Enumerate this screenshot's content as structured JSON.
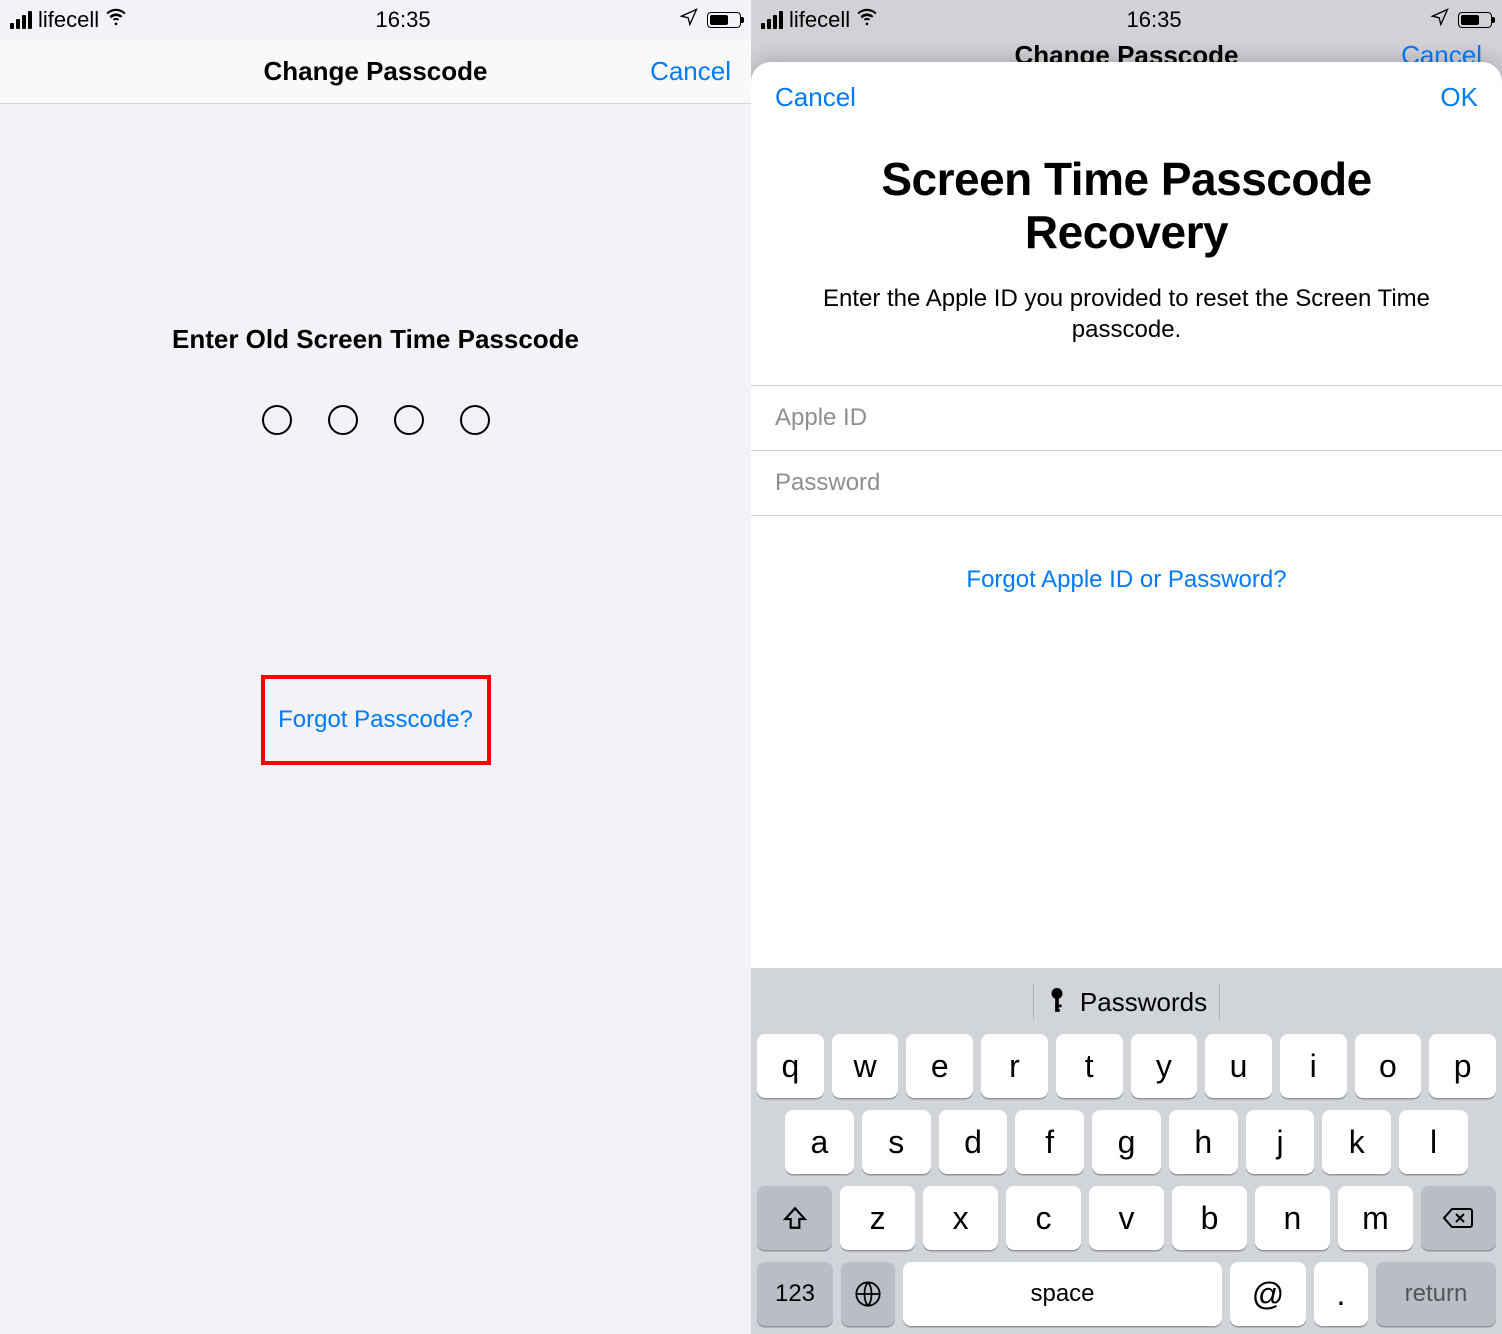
{
  "status": {
    "carrier": "lifecell",
    "time": "16:35"
  },
  "left": {
    "nav_title": "Change Passcode",
    "nav_cancel": "Cancel",
    "prompt": "Enter Old Screen Time Passcode",
    "forgot": "Forgot Passcode?"
  },
  "right": {
    "behind_title": "Change Passcode",
    "behind_cancel": "Cancel",
    "sheet_cancel": "Cancel",
    "sheet_ok": "OK",
    "title": "Screen Time Passcode Recovery",
    "desc": "Enter the Apple ID you provided to reset the Screen Time passcode.",
    "apple_id_placeholder": "Apple ID",
    "password_placeholder": "Password",
    "forgot_apple": "Forgot Apple ID or Password?"
  },
  "keyboard": {
    "suggest_label": "Passwords",
    "row1": [
      "q",
      "w",
      "e",
      "r",
      "t",
      "y",
      "u",
      "i",
      "o",
      "p"
    ],
    "row2": [
      "a",
      "s",
      "d",
      "f",
      "g",
      "h",
      "j",
      "k",
      "l"
    ],
    "row3": [
      "z",
      "x",
      "c",
      "v",
      "b",
      "n",
      "m"
    ],
    "key_123": "123",
    "key_space": "space",
    "key_at": "@",
    "key_dot": ".",
    "key_return": "return"
  }
}
